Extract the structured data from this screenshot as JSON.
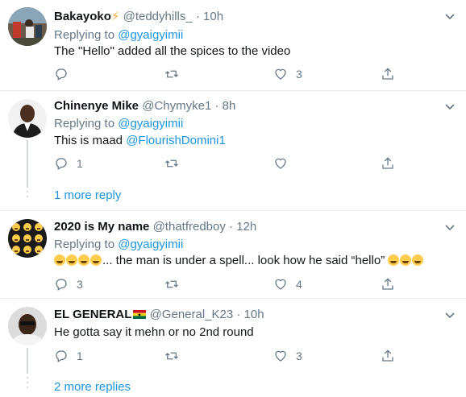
{
  "replies": [
    {
      "name": "Bakayoko",
      "name_suffix": "⚡",
      "handle": "@teddyhills_",
      "time": "10h",
      "replying_prefix": "Replying to",
      "replying_to": "@gyaigyimii",
      "text": "The \"Hello\" added all the spices to the video",
      "reply_count": "",
      "like_count": "3"
    },
    {
      "name": "Chinenye Mike",
      "handle": "@Chymyke1",
      "time": "8h",
      "replying_prefix": "Replying to",
      "replying_to": "@gyaigyimii",
      "text_prefix": "This is maad",
      "text_mention": "@FlourishDomini1",
      "reply_count": "1",
      "like_count": ""
    },
    {
      "name": "2020 is My name",
      "handle": "@thatfredboy",
      "time": "12h",
      "replying_prefix": "Replying to",
      "replying_to": "@gyaigyimii",
      "text": "... the man is under a spell... look how he said “hello”",
      "reply_count": "3",
      "like_count": "4"
    },
    {
      "name": "EL GENERAL",
      "handle": "@General_K23",
      "time": "10h",
      "text": "He gotta say it mehn or no 2nd round",
      "reply_count": "1",
      "like_count": "3"
    }
  ],
  "more_replies_1": "1 more reply",
  "more_replies_2": "2 more replies",
  "dot_separator": "·",
  "colors": {
    "link": "#1b95e0",
    "muted": "#657786",
    "divider": "#e6ecf0",
    "bolt": "#ffac33"
  },
  "icons": [
    "reply-icon",
    "retweet-icon",
    "like-icon",
    "share-icon",
    "chevron-down-icon"
  ]
}
